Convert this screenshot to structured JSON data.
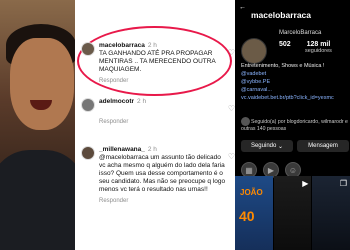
{
  "comments": [
    {
      "user": "macelobarraca",
      "time": "2 h",
      "text": "TA GANHANDO ATÉ PRA PROPAGAR MENTIRAS .. TA MERECENDO OUTRA MAQUIAGEM.",
      "reply": "Responder"
    },
    {
      "user": "adelmocotr",
      "time": "2 h",
      "text": "",
      "reply": "Responder"
    },
    {
      "user": "_millenawana_",
      "time": "2 h",
      "text": "@macelobarraca um assunto tão delicado vc acha mesmo q alguém do lado dela faria isso? Quem usa desse comportamento é o seu candidato. Mas não se preocupe q logo menos vc terá o resultado nas urnas!!",
      "reply": "Responder"
    }
  ],
  "profile": {
    "handle": "macelobarraca",
    "name": "MarceloBarraca",
    "posts": "502",
    "followers": "128 mil",
    "followers_label": "seguidores",
    "bio_lines": [
      "Entretenimento, Shows e Música !",
      "@vadebet",
      "@vybbe.PE",
      "@carnaval..."
    ],
    "link": "vc.vaidebet.bet.br/ptb?click_id=yesmc",
    "followed_by": "Seguido(a) por blogdoricardo, wilmarodr e outras 140 pessoas",
    "follow_button": "Seguindo",
    "message_button": "Mensagem",
    "post1_title": "JOÃO",
    "post1_num": "40"
  }
}
